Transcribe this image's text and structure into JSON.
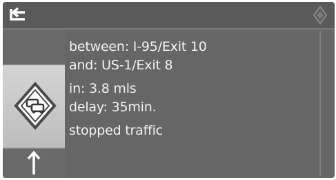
{
  "header": {
    "back_icon": "back-arrow-icon",
    "menu_icon": "options-diamond-icon"
  },
  "sidebar": {
    "selected_icon": "traffic-jam-icon",
    "bottom_icon": "up-arrow-icon"
  },
  "message": {
    "between": "between: I-95/Exit 10",
    "and": "and: US-1/Exit 8",
    "in": "in: 3.8 mls",
    "delay": "delay: 35min.",
    "status": "stopped traffic"
  },
  "colors": {
    "background": "#666666",
    "text": "#f2f2f2",
    "highlight": "#c8c8c8"
  }
}
